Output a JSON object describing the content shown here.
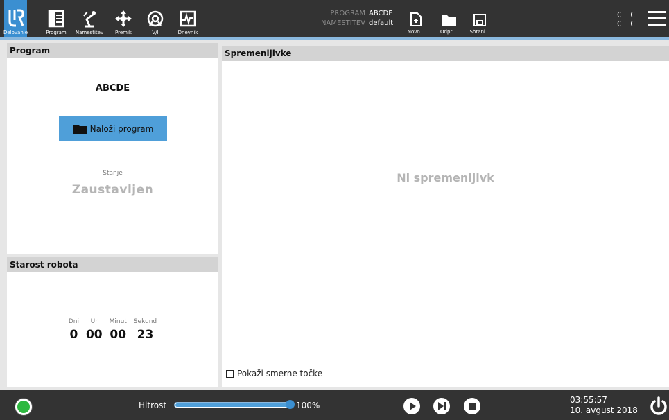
{
  "nav": {
    "items": [
      {
        "label": "Delovanje",
        "icon": "ur-logo-icon"
      },
      {
        "label": "Program",
        "icon": "program-icon"
      },
      {
        "label": "Namestitev",
        "icon": "installation-icon"
      },
      {
        "label": "Premik",
        "icon": "move-icon"
      },
      {
        "label": "V/I",
        "icon": "io-icon"
      },
      {
        "label": "Dnevnik",
        "icon": "log-icon"
      }
    ]
  },
  "program_info": {
    "program_key": "PROGRAM",
    "program_value": "ABCDE",
    "installation_key": "NAMESTITEV",
    "installation_value": "default"
  },
  "file_actions": {
    "new_label": "Novo...",
    "open_label": "Odpri...",
    "save_label": "Shrani..."
  },
  "status_cc": {
    "row1": "C C",
    "row2": "C C"
  },
  "program_panel": {
    "title": "Program",
    "program_name": "ABCDE",
    "load_button": "Naloži program",
    "state_label": "Stanje",
    "state_value": "Zaustavljen"
  },
  "robot_age": {
    "title": "Starost robota",
    "labels": {
      "days": "Dni",
      "hours": "Ur",
      "minutes": "Minut",
      "seconds": "Sekund"
    },
    "values": {
      "days": "0",
      "hours": "00",
      "minutes": "00",
      "seconds": "23"
    }
  },
  "variables_panel": {
    "title": "Spremenljivke",
    "empty_text": "Ni spremenljivk",
    "show_waypoints_label": "Pokaži smerne točke",
    "show_waypoints_checked": false
  },
  "footer": {
    "speed_label": "Hitrost",
    "speed_value": "100%",
    "speed_fraction": 1.0,
    "time": "03:55:57",
    "date": "10. avgust 2018",
    "status_color": "#2eb840"
  },
  "colors": {
    "accent": "#3b8fd1",
    "bar": "#333333",
    "button": "#4f9fd9"
  }
}
